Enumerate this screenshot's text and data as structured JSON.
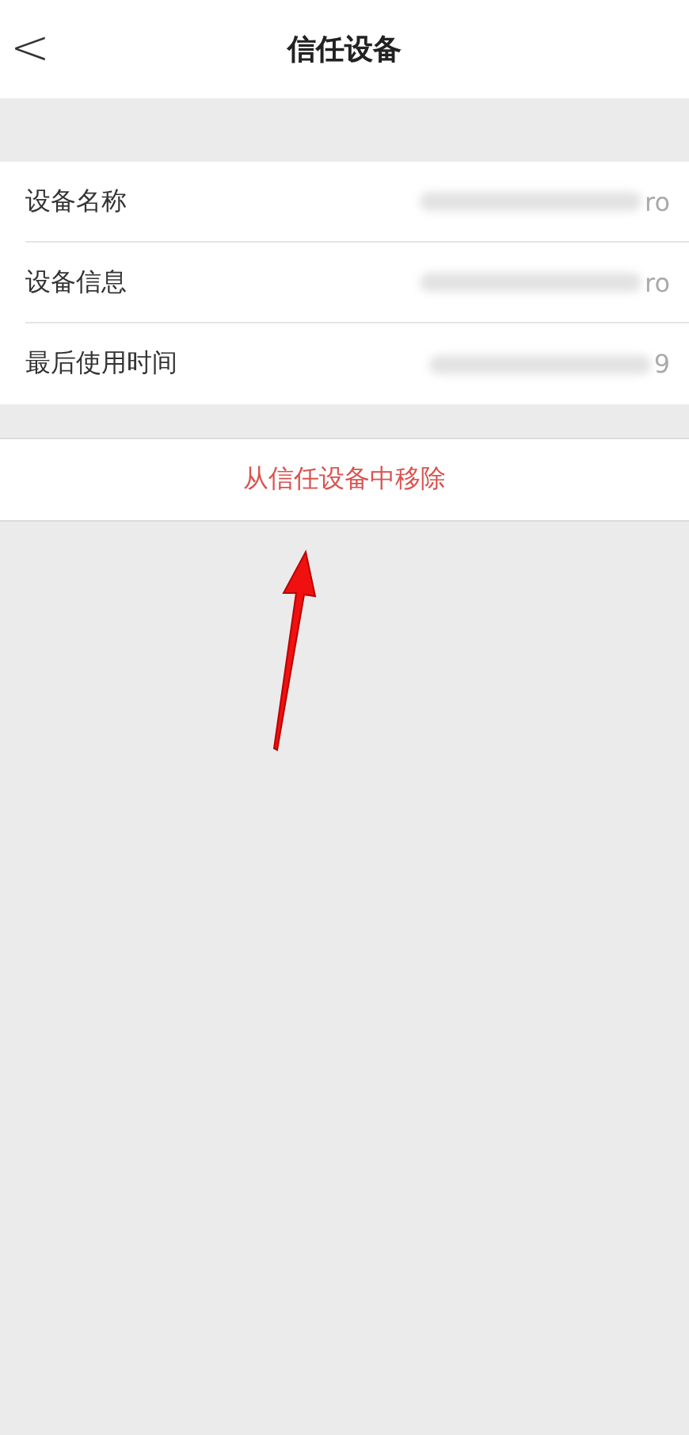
{
  "header": {
    "back": "<",
    "title": "信任设备"
  },
  "rows": [
    {
      "label": "设备名称",
      "value": "ro"
    },
    {
      "label": "设备信息",
      "value": "ro"
    },
    {
      "label": "最后使用时间",
      "value": "9"
    }
  ],
  "action": {
    "label": "从信任设备中移除"
  }
}
